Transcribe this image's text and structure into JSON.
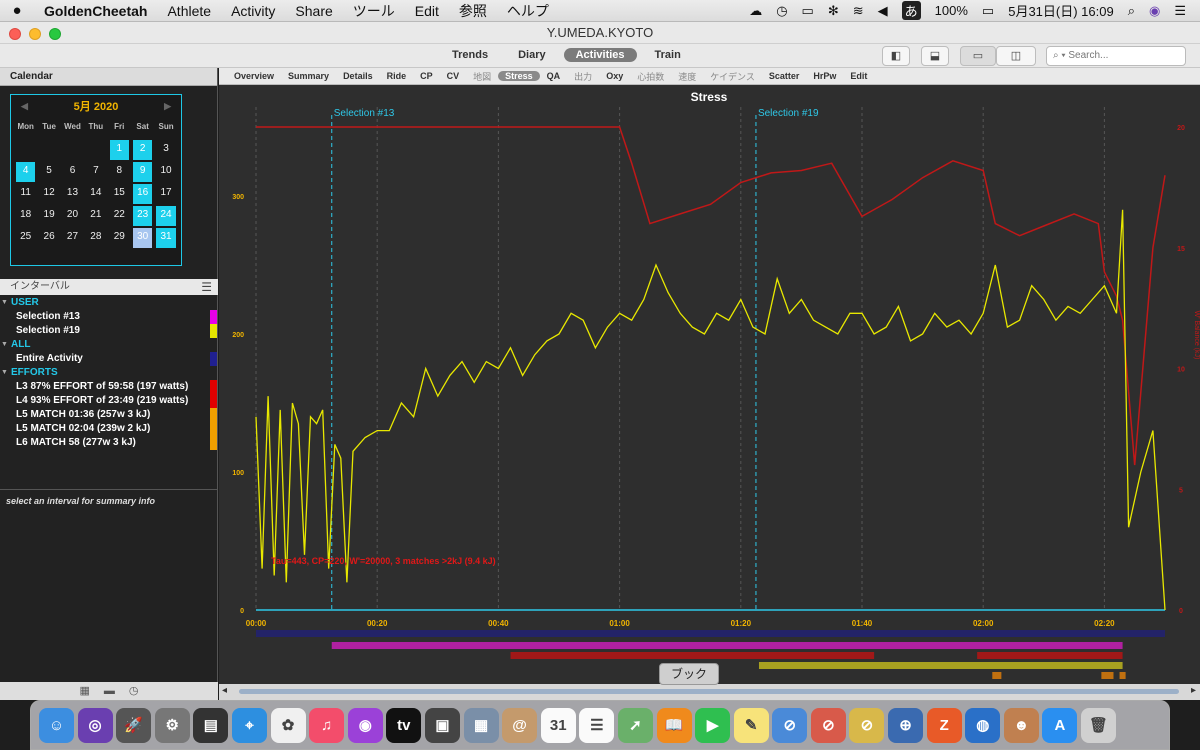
{
  "menubar": {
    "app": "GoldenCheetah",
    "items": [
      "Athlete",
      "Activity",
      "Share",
      "ツール",
      "Edit",
      "参照",
      "ヘルプ"
    ],
    "battery": "100%",
    "datetime": "5月31日(日)  16:09"
  },
  "window": {
    "title": "Y.UMEDA.KYOTO"
  },
  "toolbar": {
    "tabs": [
      "Trends",
      "Diary",
      "Activities",
      "Train"
    ],
    "active_tab": "Activities",
    "search_placeholder": "Search..."
  },
  "sidebar": {
    "calendar_header": "Calendar",
    "calendar": {
      "month": "5月",
      "year": "2020",
      "weekdays": [
        "Mon",
        "Tue",
        "Wed",
        "Thu",
        "Fri",
        "Sat",
        "Sun"
      ],
      "highlight_days": [
        1,
        2,
        4,
        9,
        16,
        23,
        24,
        31
      ],
      "selected_day": 30
    },
    "intervals_header": "インターバル",
    "intervals": [
      {
        "label": "USER",
        "group": true
      },
      {
        "label": "Selection #13",
        "color": "#e600e6"
      },
      {
        "label": "Selection #19",
        "color": "#e6e600"
      },
      {
        "label": "ALL",
        "group": true
      },
      {
        "label": "Entire Activity",
        "color": "#202090"
      },
      {
        "label": "EFFORTS",
        "group": true
      },
      {
        "label": "L3 87% EFFORT of 59:58  (197 watts)",
        "color": "#e00000"
      },
      {
        "label": "L4 93% EFFORT of 23:49  (219 watts)",
        "color": "#e00000"
      },
      {
        "label": "L5 MATCH 01:36 (257w 3 kJ)",
        "color": "#f0a000"
      },
      {
        "label": "L5 MATCH 02:04 (239w 2 kJ)",
        "color": "#f0a000"
      },
      {
        "label": "L6 MATCH 58 (277w 3 kJ)",
        "color": "#f0a000"
      }
    ],
    "summary_hint": "select an interval for summary info"
  },
  "subtabs": [
    {
      "label": "Overview"
    },
    {
      "label": "Summary"
    },
    {
      "label": "Details"
    },
    {
      "label": "Ride"
    },
    {
      "label": "CP"
    },
    {
      "label": "CV"
    },
    {
      "label": "地図",
      "light": true
    },
    {
      "label": "Stress",
      "active": true
    },
    {
      "label": "QA"
    },
    {
      "label": "出力",
      "light": true
    },
    {
      "label": "Oxy"
    },
    {
      "label": "心拍数",
      "light": true
    },
    {
      "label": "速度",
      "light": true
    },
    {
      "label": "ケイデンス",
      "light": true
    },
    {
      "label": "Scatter"
    },
    {
      "label": "HrPw"
    },
    {
      "label": "Edit"
    }
  ],
  "chart_data": {
    "type": "line",
    "title": "Stress",
    "x_ticks": [
      "00:00",
      "00:20",
      "00:40",
      "01:00",
      "01:20",
      "01:40",
      "02:00",
      "02:20"
    ],
    "xlim_minutes": [
      0,
      150
    ],
    "y_left_ticks": [
      0,
      100,
      200,
      300
    ],
    "ylim_left": [
      0,
      350
    ],
    "y_right_label": "W' Balance (kJ)",
    "y_right_ticks": [
      0,
      5,
      10,
      15,
      20
    ],
    "ylim_right": [
      0,
      20
    ],
    "selections": [
      {
        "name": "Selection #13",
        "x_min": 12.5
      },
      {
        "name": "Selection #19",
        "x_min": 82.5
      }
    ],
    "annotation": "Tau=443, CP=220, W'=20000, 3 matches >2kJ (9.4 kJ)",
    "power_series": {
      "name": "Power",
      "x_min": [
        0,
        1,
        2,
        3,
        4,
        5,
        6,
        7,
        8,
        9,
        10,
        11,
        12,
        13,
        14,
        15,
        16,
        18,
        20,
        22,
        24,
        26,
        28,
        30,
        32,
        34,
        36,
        38,
        40,
        42,
        44,
        46,
        48,
        50,
        52,
        54,
        56,
        58,
        60,
        62,
        64,
        66,
        68,
        70,
        72,
        74,
        76,
        78,
        80,
        82,
        84,
        86,
        88,
        90,
        92,
        94,
        96,
        98,
        100,
        102,
        104,
        106,
        108,
        110,
        112,
        114,
        116,
        118,
        120,
        122,
        124,
        126,
        128,
        130,
        132,
        134,
        136,
        138,
        140,
        142,
        143,
        144,
        146,
        148,
        150
      ],
      "y_watts": [
        140,
        30,
        155,
        25,
        145,
        20,
        150,
        135,
        40,
        140,
        135,
        145,
        30,
        120,
        110,
        20,
        115,
        125,
        130,
        130,
        150,
        140,
        175,
        155,
        170,
        180,
        165,
        180,
        175,
        190,
        170,
        185,
        195,
        200,
        215,
        210,
        190,
        205,
        215,
        210,
        225,
        250,
        230,
        215,
        205,
        200,
        215,
        210,
        225,
        205,
        200,
        240,
        215,
        225,
        210,
        205,
        200,
        215,
        215,
        200,
        205,
        220,
        195,
        200,
        215,
        205,
        210,
        200,
        215,
        250,
        205,
        210,
        235,
        225,
        210,
        220,
        215,
        225,
        235,
        215,
        290,
        60,
        100,
        130,
        0
      ]
    },
    "wbal_series": {
      "name": "W' Balance",
      "x_min": [
        0,
        60,
        62,
        65,
        70,
        75,
        80,
        85,
        90,
        95,
        100,
        105,
        110,
        115,
        120,
        122,
        126,
        130,
        135,
        139,
        140,
        142,
        143,
        145,
        148,
        150
      ],
      "y_kj": [
        20,
        20,
        18.5,
        16,
        16.4,
        16.8,
        17.7,
        18.1,
        18.2,
        18.5,
        16.3,
        17,
        17.9,
        18.6,
        18.2,
        16,
        15.5,
        15.9,
        16.4,
        16,
        14,
        13,
        12,
        6,
        15,
        18
      ]
    },
    "interval_bars": [
      {
        "color": "#232368",
        "x0": 0,
        "x1": 150
      },
      {
        "color": "#b020a0",
        "x0": 12.5,
        "x1": 143
      },
      {
        "color": "#a01818",
        "x0": 42,
        "x1": 102
      },
      {
        "color": "#a01818",
        "x0": 119,
        "x1": 143
      },
      {
        "color": "#a8a020",
        "x0": 83,
        "x1": 143
      },
      {
        "color": "#c07010",
        "x0": 121.5,
        "x1": 123
      },
      {
        "color": "#c07010",
        "x0": 139.5,
        "x1": 141.5
      },
      {
        "color": "#c07010",
        "x0": 142.5,
        "x1": 143.5
      }
    ]
  },
  "tooltip": "ブック",
  "dock": [
    {
      "name": "finder",
      "color": "#3c8ee0",
      "glyph": "☺"
    },
    {
      "name": "siri",
      "color": "#6a3fb0",
      "glyph": "◎"
    },
    {
      "name": "launchpad",
      "color": "#555",
      "glyph": "🚀"
    },
    {
      "name": "system-preferences",
      "color": "#777",
      "glyph": "⚙"
    },
    {
      "name": "photo-booth",
      "color": "#333",
      "glyph": "▤"
    },
    {
      "name": "safari",
      "color": "#2d8fe0",
      "glyph": "⌖"
    },
    {
      "name": "photos",
      "color": "#f0f0f0",
      "glyph": "✿"
    },
    {
      "name": "music",
      "color": "#f34d6b",
      "glyph": "♫"
    },
    {
      "name": "podcasts",
      "color": "#9b41d8",
      "glyph": "◉"
    },
    {
      "name": "tv",
      "color": "#111",
      "glyph": "tv"
    },
    {
      "name": "photo-viewer",
      "color": "#444",
      "glyph": "▣"
    },
    {
      "name": "preview",
      "color": "#7a8fa8",
      "glyph": "▦"
    },
    {
      "name": "contacts",
      "color": "#c49a6c",
      "glyph": "@"
    },
    {
      "name": "calendar",
      "color": "#fafafa",
      "glyph": "31"
    },
    {
      "name": "reminders",
      "color": "#fafafa",
      "glyph": "☰"
    },
    {
      "name": "maps",
      "color": "#6ab06a",
      "glyph": "➚"
    },
    {
      "name": "books",
      "color": "#f08a1c",
      "glyph": "📖"
    },
    {
      "name": "facetime",
      "color": "#2fbf50",
      "glyph": "▶"
    },
    {
      "name": "notes",
      "color": "#f7e37a",
      "glyph": "✎"
    },
    {
      "name": "blocked-app-1",
      "color": "#4a8ad8",
      "glyph": "⊘"
    },
    {
      "name": "blocked-app-2",
      "color": "#d85a4a",
      "glyph": "⊘"
    },
    {
      "name": "blocked-app-3",
      "color": "#d8b84a",
      "glyph": "⊘"
    },
    {
      "name": "app-target",
      "color": "#3a6ab0",
      "glyph": "⊕"
    },
    {
      "name": "app-z",
      "color": "#e85a28",
      "glyph": "Z"
    },
    {
      "name": "app-globe",
      "color": "#2a70c8",
      "glyph": "◍"
    },
    {
      "name": "app-character",
      "color": "#c08050",
      "glyph": "☻"
    },
    {
      "name": "app-store",
      "color": "#2a8ff0",
      "glyph": "A"
    },
    {
      "name": "trash",
      "color": "#d0d0d0",
      "glyph": "🗑"
    }
  ]
}
